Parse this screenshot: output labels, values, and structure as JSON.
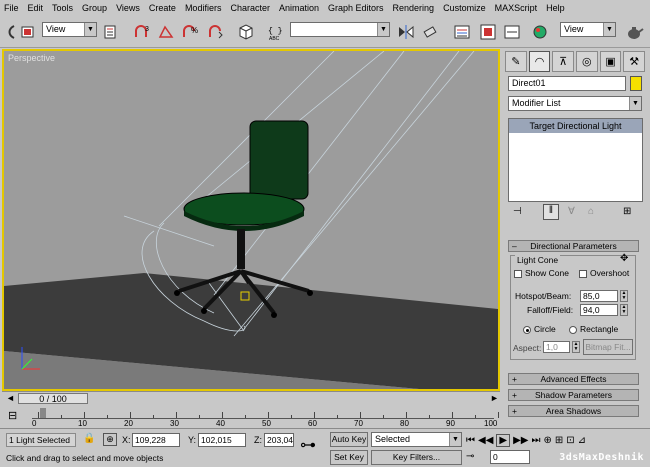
{
  "menu": [
    "File",
    "Edit",
    "Tools",
    "Group",
    "Views",
    "Create",
    "Modifiers",
    "Character",
    "Animation",
    "Graph Editors",
    "Rendering",
    "Customize",
    "MAXScript",
    "Help"
  ],
  "toolbar": {
    "view_dropdown_1": "View",
    "view_dropdown_2": "View",
    "named_selection": "",
    "icons": [
      "undo-icon",
      "select-icon",
      "select-by-name-icon",
      "select-region-icon",
      "move-icon",
      "rotate-icon",
      "scale-icon",
      "select-manipulate-icon",
      "snap-3d-icon",
      "angle-snap-icon",
      "percent-snap-icon",
      "spinner-snap-icon",
      "keyboard-shortcut-icon",
      "mirror-icon",
      "align-icon",
      "layer-icon",
      "curve-editor-icon",
      "schematic-icon",
      "material-editor-icon",
      "render-scene-icon",
      "quick-render-icon",
      "teapot-icon"
    ]
  },
  "viewport": {
    "label": "Perspective"
  },
  "command_panel": {
    "tabs": [
      "create-tab-icon",
      "modify-tab-icon",
      "hierarchy-tab-icon",
      "motion-tab-icon",
      "display-tab-icon",
      "utilities-tab-icon"
    ],
    "object_name": "Direct01",
    "object_color": "#f5e000",
    "modifier_list": "Modifier List",
    "stack_items": [
      "Target Directional Light"
    ],
    "directional": {
      "header": "Directional Parameters",
      "group_label": "Light Cone",
      "show_cone": "Show Cone",
      "overshoot": "Overshoot",
      "hotspot_label": "Hotspot/Beam:",
      "hotspot_value": "85,0",
      "falloff_label": "Falloff/Field:",
      "falloff_value": "94,0",
      "circle": "Circle",
      "rectangle": "Rectangle",
      "aspect_label": "Aspect:",
      "aspect_value": "1,0",
      "bitmap_fit": "Bitmap Fit..."
    },
    "rollouts": [
      "Advanced Effects",
      "Shadow Parameters",
      "Area Shadows"
    ]
  },
  "timeline": {
    "position": "0 / 100",
    "ticks": [
      "0",
      "10",
      "20",
      "30",
      "40",
      "50",
      "60",
      "70",
      "80",
      "90",
      "100"
    ]
  },
  "status": {
    "selection": "1 Light Selected",
    "x_label": "X:",
    "x_value": "109,228",
    "y_label": "Y:",
    "y_value": "102,015",
    "z_label": "Z:",
    "z_value": "203,04",
    "prompt": "Click and drag to select and move objects",
    "auto_key": "Auto Key",
    "set_key": "Set Key",
    "key_mode": "Selected",
    "key_filters": "Key Filters...",
    "frame": "0"
  },
  "watermark": "3dsMaxDeshnik"
}
